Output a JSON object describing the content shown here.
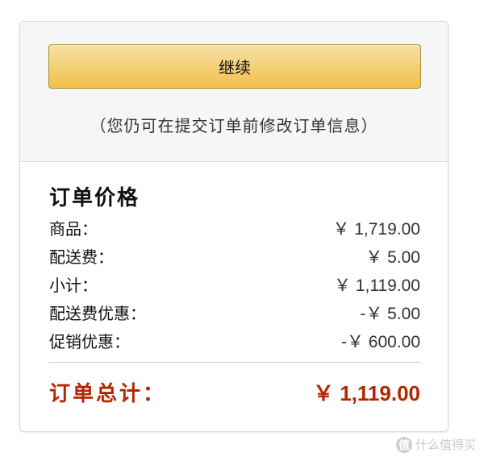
{
  "continue_button": {
    "label": "继续"
  },
  "hint": "（您仍可在提交订单前修改订单信息）",
  "order_summary": {
    "title": "订单价格",
    "items": [
      {
        "label": "商品：",
        "value": "￥ 1,719.00"
      },
      {
        "label": "配送费：",
        "value": "￥ 5.00"
      },
      {
        "label": "小计：",
        "value": "￥ 1,119.00"
      },
      {
        "label": "配送费优惠：",
        "value": "-￥ 5.00"
      },
      {
        "label": "促销优惠：",
        "value": "-￥ 600.00"
      }
    ],
    "total": {
      "label": "订单总计：",
      "value": "￥ 1,119.00"
    }
  },
  "watermark": {
    "logo": "值",
    "text": "什么值得买"
  },
  "colors": {
    "button_top": "#f7dfa5",
    "button_bottom": "#f0c14b",
    "button_border": "#a88734",
    "total_red": "#b12704",
    "panel_gray": "#f6f6f6"
  }
}
